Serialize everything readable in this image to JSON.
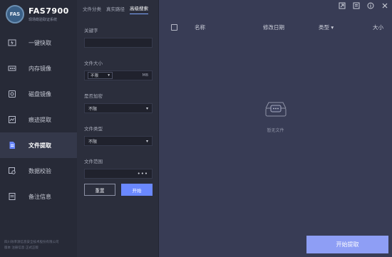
{
  "brand": {
    "logo_text": "FAS",
    "title": "FAS7900",
    "subtitle": "现场勘验取证系统"
  },
  "sidebar": {
    "items": [
      {
        "label": "一键快取",
        "icon": "lightning-icon",
        "active": false
      },
      {
        "label": "内存镜像",
        "icon": "memory-icon",
        "active": false
      },
      {
        "label": "磁盘镜像",
        "icon": "disk-icon",
        "active": false
      },
      {
        "label": "痕迹提取",
        "icon": "trace-icon",
        "active": false
      },
      {
        "label": "文件提取",
        "icon": "file-icon",
        "active": true
      },
      {
        "label": "数据校验",
        "icon": "verify-icon",
        "active": false
      },
      {
        "label": "备注信息",
        "icon": "note-icon",
        "active": false
      }
    ],
    "footer_line1": "四川效率源信息安全技术股份有限公司",
    "footer_line2": "版本    注册信息    正式正版"
  },
  "tabs": [
    {
      "label": "文件分类",
      "active": false
    },
    {
      "label": "真实路径",
      "active": false
    },
    {
      "label": "高级搜索",
      "active": true
    }
  ],
  "form": {
    "keyword_label": "关键字",
    "keyword_value": "",
    "size_label": "文件大小",
    "size_select": "不限",
    "size_unit": "MB",
    "encrypted_label": "是否加密",
    "encrypted_value": "不限",
    "type_label": "文件类型",
    "type_value": "不限",
    "scope_label": "文件范围",
    "scope_button": "•••",
    "reset_label": "重置",
    "start_label": "开始"
  },
  "table": {
    "columns": [
      "名称",
      "修改日期",
      "类型 ▾",
      "大小"
    ],
    "empty_text": "暂无文件"
  },
  "actions": {
    "extract_label": "开始提取"
  },
  "window_controls": [
    "minimize-to-tray-icon",
    "screenshot-icon",
    "info-icon",
    "close-icon"
  ],
  "colors": {
    "accent": "#6a88ff",
    "extract_button": "#8e9ef5",
    "sidebar_bg": "#272a37",
    "content_bg": "#383c55"
  }
}
